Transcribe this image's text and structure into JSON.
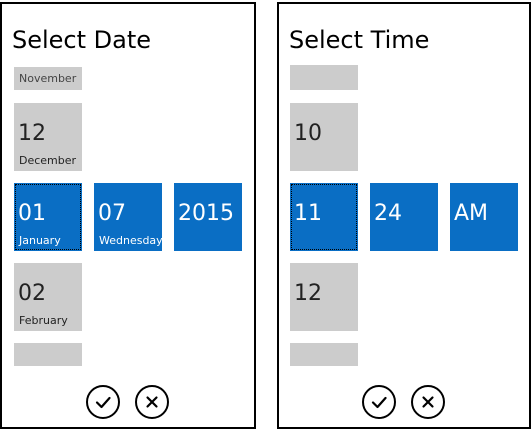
{
  "date_picker": {
    "title": "Select Date",
    "above_partial_label": "November",
    "prev_item": {
      "number": "12",
      "label": "December"
    },
    "selected": {
      "day": {
        "number": "01",
        "label": "January"
      },
      "weekday": {
        "number": "07",
        "label": "Wednesday"
      },
      "year": {
        "number": "2015"
      }
    },
    "next_item": {
      "number": "02",
      "label": "February"
    },
    "accept_icon": "checkmark-icon",
    "cancel_icon": "close-icon"
  },
  "time_picker": {
    "title": "Select Time",
    "prev_item": {
      "number": "10"
    },
    "selected": {
      "hour": {
        "number": "11"
      },
      "minute": {
        "number": "24"
      },
      "period": {
        "number": "AM"
      }
    },
    "next_item": {
      "number": "12"
    },
    "accept_icon": "checkmark-icon",
    "cancel_icon": "close-icon"
  },
  "colors": {
    "selected": "#0a6ec4",
    "unselected": "#cccccc",
    "border": "#000000"
  }
}
